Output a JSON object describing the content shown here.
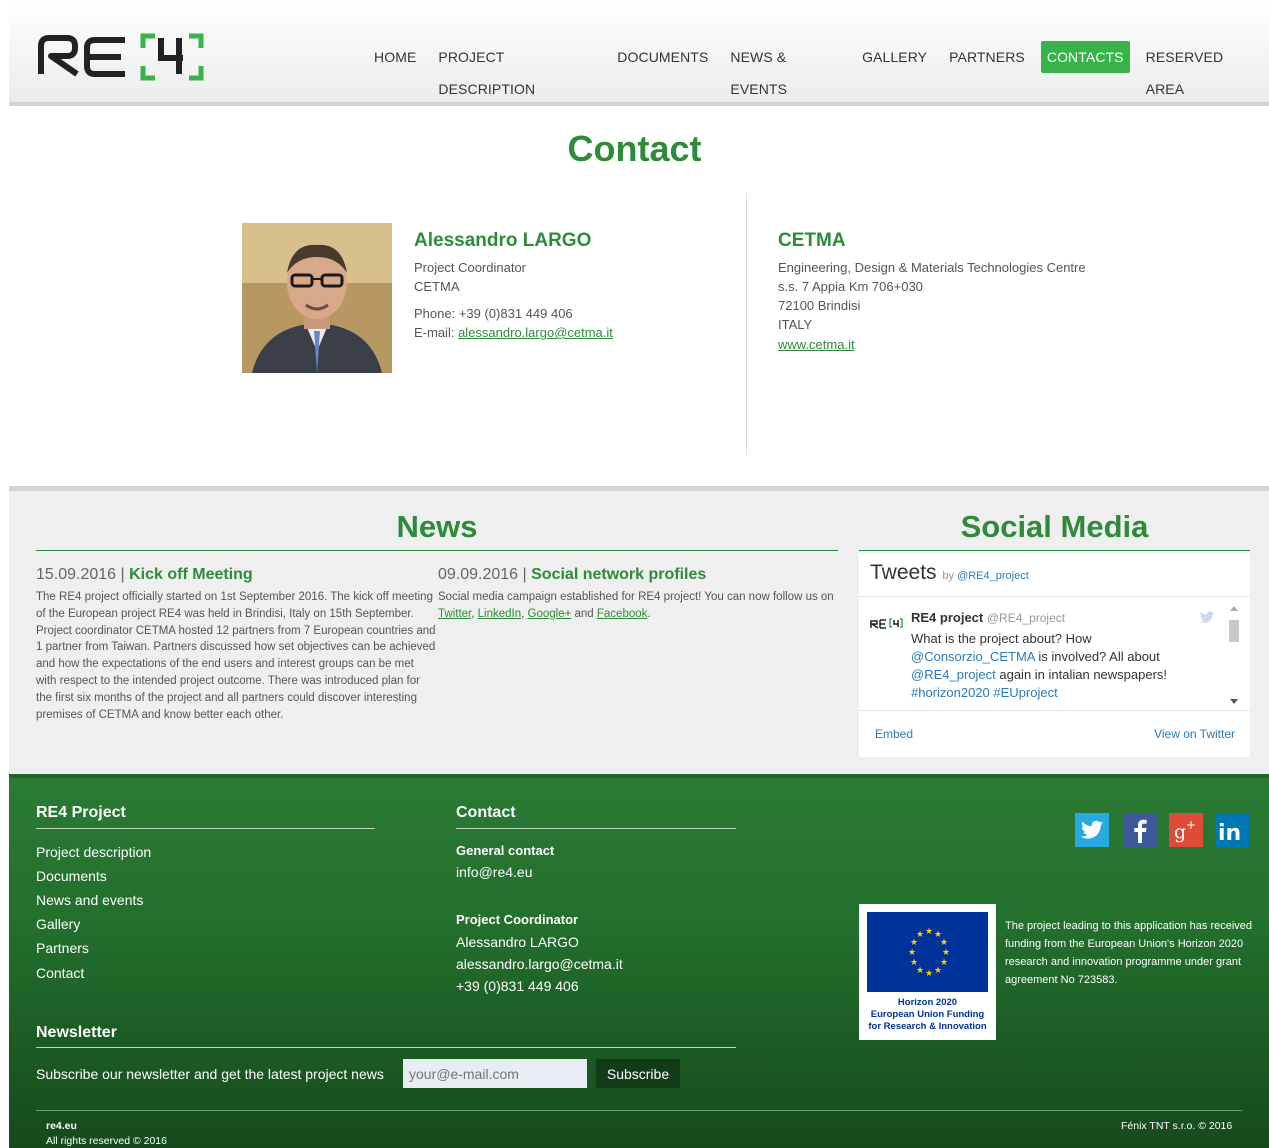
{
  "brand": {
    "accent": "#37b34a",
    "title_green": "#2d8b39",
    "footer_green": "#236f2c"
  },
  "header": {
    "logo_alt": "RE4",
    "nav": [
      {
        "label": "HOME",
        "active": false
      },
      {
        "label": "PROJECT DESCRIPTION",
        "active": false
      },
      {
        "label": "DOCUMENTS",
        "active": false
      },
      {
        "label": "NEWS & EVENTS",
        "active": false
      },
      {
        "label": "GALLERY",
        "active": false
      },
      {
        "label": "PARTNERS",
        "active": false
      },
      {
        "label": "CONTACTS",
        "active": true
      },
      {
        "label": "RESERVED AREA",
        "active": false
      }
    ]
  },
  "contact": {
    "title": "Contact",
    "person": {
      "name": "Alessandro LARGO",
      "role": "Project Coordinator",
      "org": "CETMA",
      "phone": "Phone: +39 (0)831 449 406",
      "email_label": "E-mail:",
      "email": "alessandro.largo@cetma.it"
    },
    "company": {
      "name": "CETMA",
      "lines": [
        "Engineering, Design & Materials Technologies Centre",
        "s.s. 7 Appia Km 706+030",
        "72100 Brindisi",
        "ITALY"
      ],
      "website": "www.cetma.it"
    }
  },
  "news": {
    "title": "News",
    "items": [
      {
        "date": "15.09.2016",
        "headline": "Kick off Meeting",
        "body": "The RE4 project officially started on 1st September 2016. The kick off meeting of the European project RE4 was held in Brindisi, Italy on 15th September. Project coordinator CETMA hosted 12 partners from 7 European countries and 1 partner from Taiwan. Partners discussed how set objectives can be achieved and how the expectations of the end users and interest groups can be met with respect to the intended project outcome. There was introduced plan for the first six months of the project and all partners could discover interesting premises of CETMA and know better each other."
      },
      {
        "date": "09.09.2016",
        "headline": "Social network profiles",
        "body_prefix": "Social media campaign established for RE4 project! You can now follow us on ",
        "links": [
          "Twitter",
          "LinkedIn",
          "Google+",
          "Facebook"
        ],
        "link_sep": ", ",
        "link_and": " and ",
        "body_suffix": "."
      }
    ]
  },
  "social": {
    "title": "Social Media",
    "tweets_label": "Tweets",
    "by_label": "by",
    "account": "@RE4_project",
    "tweet": {
      "author": "RE4 project",
      "handle": "@RE4_project",
      "text_1": "What is the project about? How",
      "mention_1": "@Consorzio_CETMA",
      "text_2": " is involved? All about",
      "mention_2": "@RE4_project",
      "text_3": " again in intalian newspapers!",
      "hashtags": "#horizon2020 #EUproject"
    },
    "embed": "Embed",
    "view": "View on Twitter",
    "colors": {
      "twitter_blue": "#2b7bb9"
    }
  },
  "footer": {
    "project_title": "RE4 Project",
    "project_links": [
      "Project description",
      "Documents",
      "News and events",
      "Gallery",
      "Partners",
      "Contact"
    ],
    "contact_title": "Contact",
    "general_label": "General contact",
    "general_email": "info@re4.eu",
    "coord_label": "Project Coordinator",
    "coord_name": "Alessandro LARGO",
    "coord_email": "alessandro.largo@cetma.it",
    "coord_phone": "+39 (0)831 449 406",
    "social_icons": [
      "twitter-icon",
      "facebook-icon",
      "google-plus-icon",
      "linkedin-icon"
    ],
    "eu_caption": [
      "Horizon 2020",
      "European Union Funding",
      "for Research & Innovation"
    ],
    "eu_text": "The project leading to this application has received funding from the European Union's Horizon 2020 research and innovation programme under grant agreement No 723583.",
    "newsletter_title": "Newsletter",
    "newsletter_text": "Subscribe our newsletter and get the latest project news",
    "newsletter_placeholder": "your@e-mail.com",
    "newsletter_button": "Subscribe",
    "site": "re4.eu",
    "rights": "All rights reserved © 2016",
    "credit": "Fénix TNT s.r.o. © 2016"
  }
}
